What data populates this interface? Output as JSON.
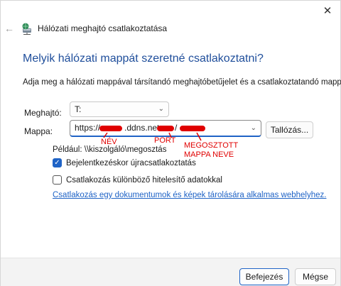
{
  "window": {
    "title": "Hálózati meghajtó csatlakoztatása",
    "close_glyph": "✕",
    "back_glyph": "←"
  },
  "main": {
    "heading": "Melyik hálózati mappát szeretné csatlakoztatni?",
    "instructions": "Adja meg a hálózati mappával társítandó meghajtóbetűjelet és a csatlakoztatandó mappát:",
    "drive_label": "Meghajtó:",
    "drive_value": "T:",
    "folder_label": "Mappa:",
    "folder_value": {
      "prefix": "https://",
      "domain": ".ddns.net:",
      "separator": "/"
    },
    "browse_label": "Tallózás...",
    "example": "Például: \\\\kiszolgáló\\megosztás",
    "reconnect_label": "Bejelentkezéskor újracsatlakoztatás",
    "reconnect_checked": true,
    "credentials_label": "Csatlakozás különböző hitelesítő adatokkal",
    "credentials_checked": false,
    "link_text": "Csatlakozás egy dokumentumok és képek tárolására alkalmas webhelyhez."
  },
  "annotations": {
    "name": "NÉV",
    "port": "PORT",
    "share_line1": "MEGOSZTOTT",
    "share_line2": "MAPPA NEVE",
    "color": "#e00000"
  },
  "footer": {
    "finish_label": "Befejezés",
    "cancel_label": "Mégse"
  },
  "colors": {
    "accent": "#1f63c6",
    "heading": "#1f4e9b"
  },
  "icons": {
    "back": "back-arrow-icon",
    "wizard": "network-drive-icon",
    "close": "close-icon",
    "dropdown": "chevron-down-icon",
    "check": "checkmark-icon"
  }
}
